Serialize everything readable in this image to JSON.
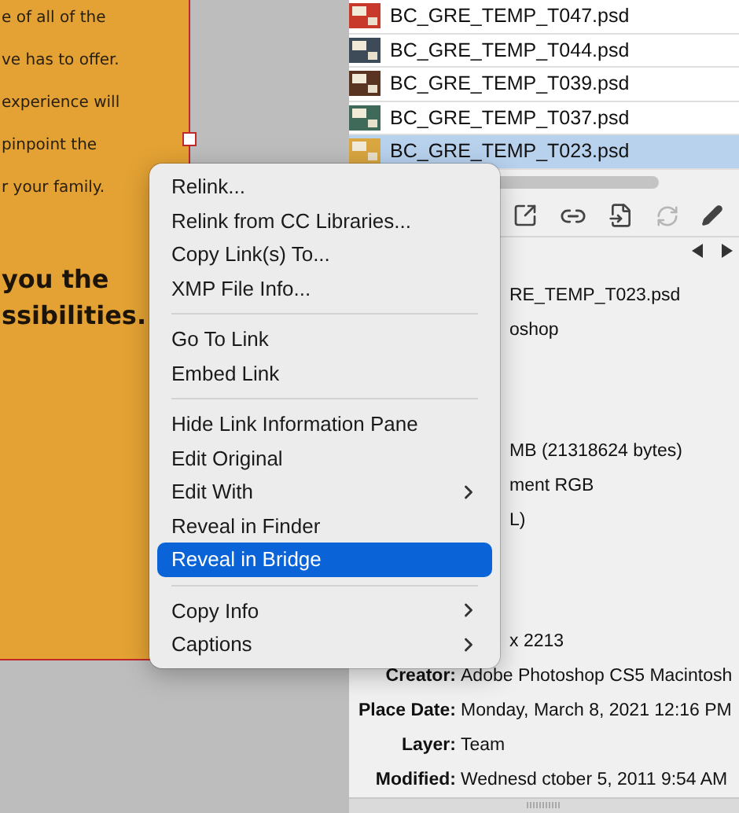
{
  "page_text": {
    "lines": [
      "e of all of the",
      "ve has to offer.",
      "experience will",
      "pinpoint the",
      "r your family."
    ],
    "headline": [
      "you the",
      "ssibilities."
    ]
  },
  "links": [
    {
      "name": "BC_GRE_TEMP_T047.psd",
      "selected": false,
      "color": "#c8392b"
    },
    {
      "name": "BC_GRE_TEMP_T044.psd",
      "selected": false,
      "color": "#3d4a57"
    },
    {
      "name": "BC_GRE_TEMP_T039.psd",
      "selected": false,
      "color": "#5a3422"
    },
    {
      "name": "BC_GRE_TEMP_T037.psd",
      "selected": false,
      "color": "#3f6a5a"
    },
    {
      "name": "BC_GRE_TEMP_T023.psd",
      "selected": true,
      "color": "#d9a640"
    }
  ],
  "toolbar": [
    {
      "kind": "relink",
      "disabled": false
    },
    {
      "kind": "link",
      "disabled": false
    },
    {
      "kind": "goto",
      "disabled": false
    },
    {
      "kind": "update",
      "disabled": true
    },
    {
      "kind": "edit",
      "disabled": false
    }
  ],
  "info_sections": [
    [
      {
        "kind": "covered",
        "value": "RE_TEMP_T023.psd"
      },
      {
        "kind": "covered",
        "value": "oshop"
      }
    ],
    [
      {
        "kind": "covered",
        "value": "MB (21318624 bytes)"
      },
      {
        "kind": "covered",
        "value": "ment RGB"
      },
      {
        "kind": "covered",
        "value": "L)"
      }
    ],
    [
      {
        "kind": "covered",
        "value": "x 2213"
      },
      {
        "kind": "field",
        "label": "Creator:",
        "value": "Adobe Photoshop CS5 Macintosh"
      },
      {
        "kind": "field",
        "label": "Place Date:",
        "value": "Monday, March 8, 2021 12:16 PM"
      },
      {
        "kind": "field",
        "label": "Layer:",
        "value": "Team"
      },
      {
        "kind": "field",
        "label": "Modified:",
        "value": "Wednesd   ctober 5, 2011 9:54 AM"
      }
    ]
  ],
  "menu": [
    [
      {
        "label": "Relink...",
        "submenu": false,
        "selected": false
      },
      {
        "label": "Relink from CC Libraries...",
        "submenu": false,
        "selected": false
      },
      {
        "label": "Copy Link(s) To...",
        "submenu": false,
        "selected": false
      },
      {
        "label": "XMP File Info...",
        "submenu": false,
        "selected": false
      }
    ],
    [
      {
        "label": "Go To Link",
        "submenu": false,
        "selected": false
      },
      {
        "label": "Embed Link",
        "submenu": false,
        "selected": false
      }
    ],
    [
      {
        "label": "Hide Link Information Pane",
        "submenu": false,
        "selected": false
      },
      {
        "label": "Edit Original",
        "submenu": false,
        "selected": false
      },
      {
        "label": "Edit With",
        "submenu": true,
        "selected": false
      },
      {
        "label": "Reveal in Finder",
        "submenu": false,
        "selected": false
      },
      {
        "label": "Reveal in Bridge",
        "submenu": false,
        "selected": true
      }
    ],
    [
      {
        "label": "Copy Info",
        "submenu": true,
        "selected": false
      },
      {
        "label": "Captions",
        "submenu": true,
        "selected": false
      }
    ]
  ]
}
